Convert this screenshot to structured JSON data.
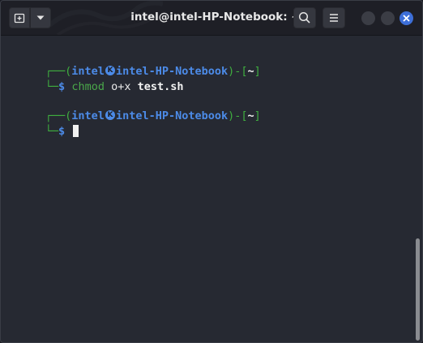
{
  "window": {
    "title": "intel@intel-HP-Notebook: ~"
  },
  "icons": {
    "new_tab": "new-tab-icon",
    "dropdown": "chevron-down-icon",
    "search": "search-icon",
    "menu": "hamburger-menu-icon",
    "close": "close-icon",
    "kali": "kali-logo-icon"
  },
  "colors": {
    "titlebar": "#1e1f26",
    "terminal_bg": "#262932",
    "prompt_green": "#3fae3f",
    "prompt_blue": "#4c8be8",
    "close_blue": "#3d6fd8"
  },
  "terminal": {
    "blocks": [
      {
        "prompt_open": "┌──(",
        "user": "intel",
        "host": "intel-HP-Notebook",
        "prompt_mid": ")-[",
        "cwd": "~",
        "prompt_close": "]",
        "prompt_prefix": "└─",
        "prompt_symbol": "$",
        "command": "chmod",
        "args": "o+x",
        "target": "test.sh"
      },
      {
        "prompt_open": "┌──(",
        "user": "intel",
        "host": "intel-HP-Notebook",
        "prompt_mid": ")-[",
        "cwd": "~",
        "prompt_close": "]",
        "prompt_prefix": "└─",
        "prompt_symbol": "$"
      }
    ]
  }
}
